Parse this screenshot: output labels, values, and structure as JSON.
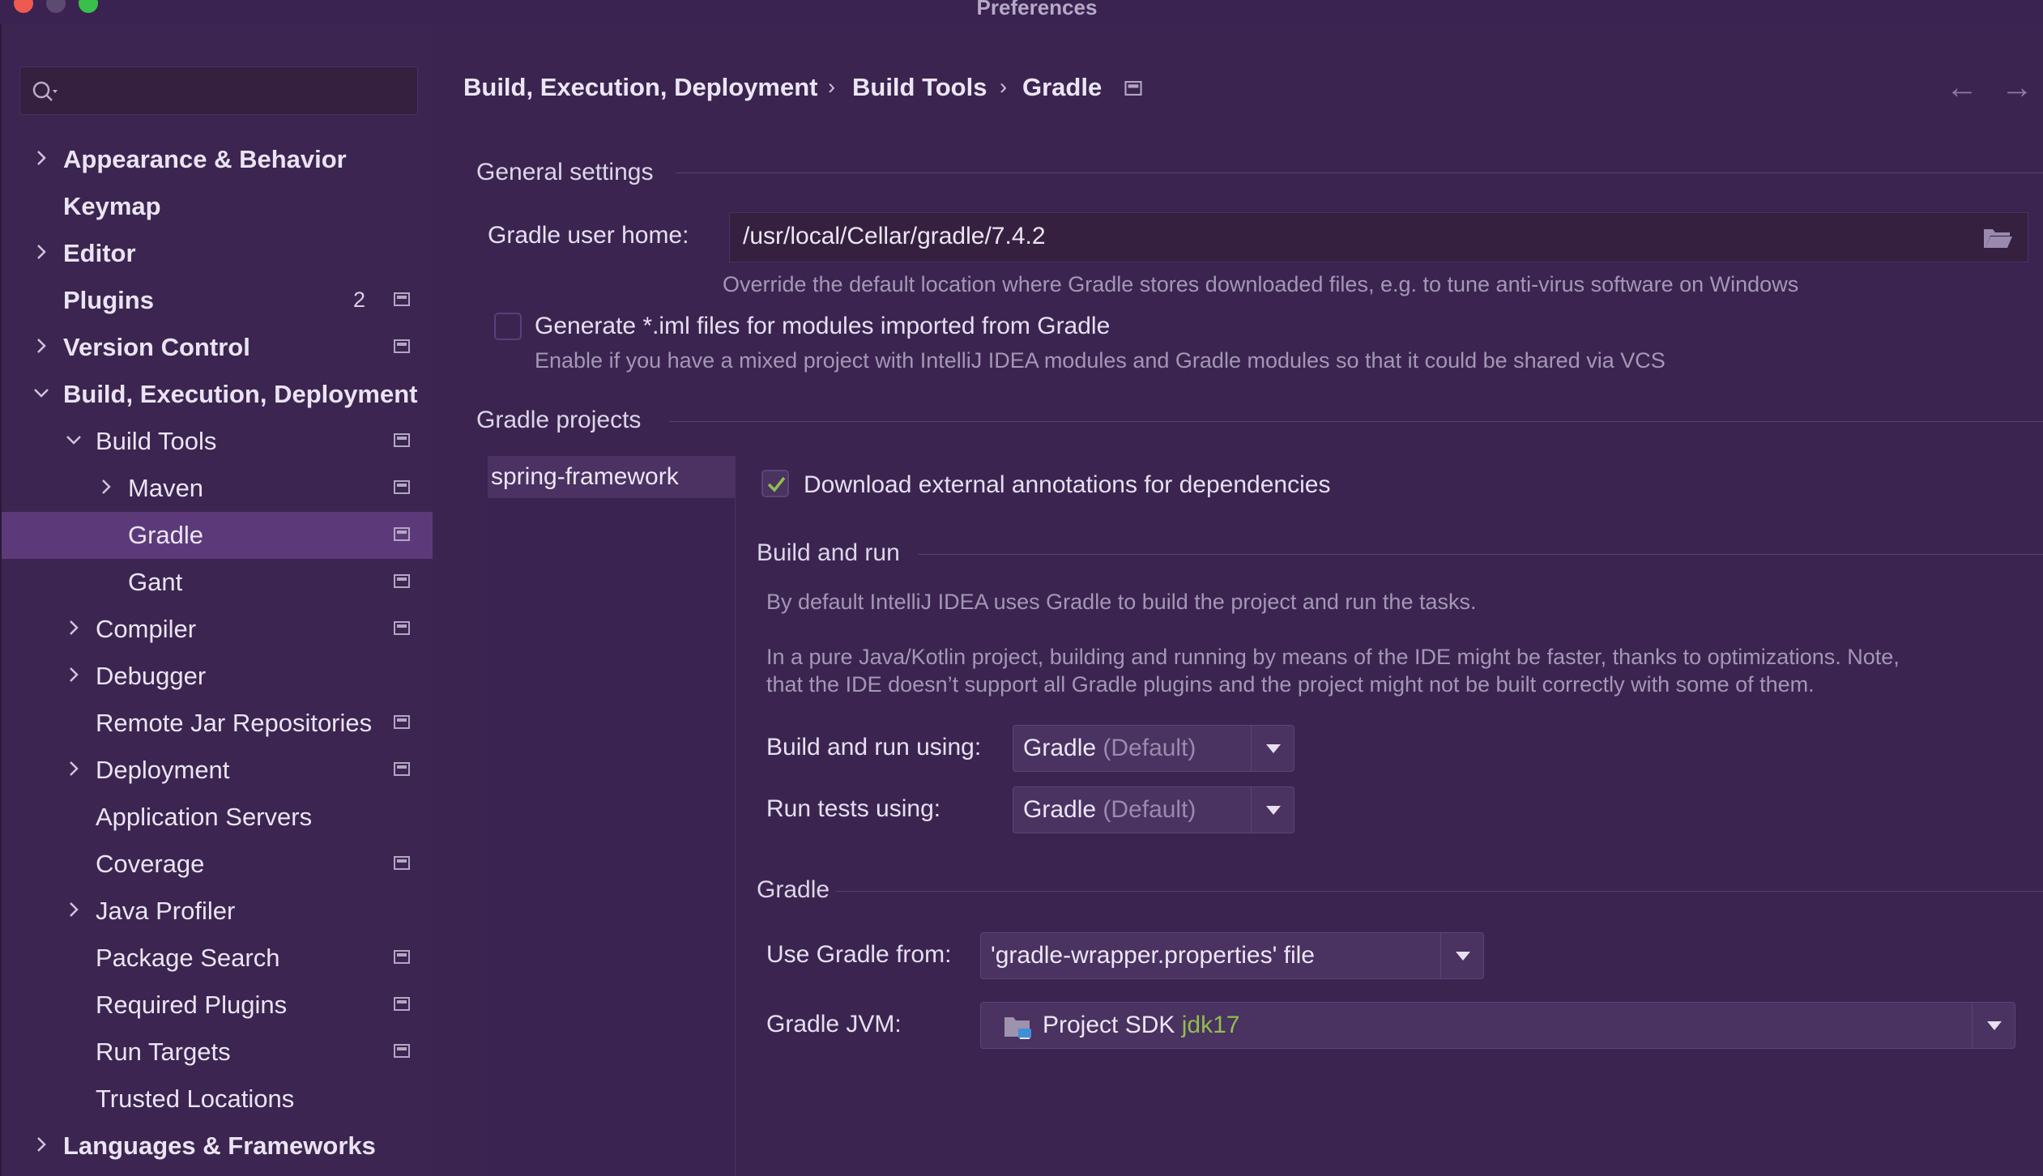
{
  "window": {
    "title": "Preferences"
  },
  "search": {
    "placeholder": ""
  },
  "sidebar": {
    "items": [
      {
        "label": "Appearance & Behavior",
        "bold": true
      },
      {
        "label": "Keymap",
        "bold": true
      },
      {
        "label": "Editor",
        "bold": true
      },
      {
        "label": "Plugins",
        "bold": true,
        "count": "2"
      },
      {
        "label": "Version Control",
        "bold": true
      },
      {
        "label": "Build, Execution, Deployment",
        "bold": true
      },
      {
        "label": "Build Tools"
      },
      {
        "label": "Maven"
      },
      {
        "label": "Gradle",
        "selected": true
      },
      {
        "label": "Gant"
      },
      {
        "label": "Compiler"
      },
      {
        "label": "Debugger"
      },
      {
        "label": "Remote Jar Repositories"
      },
      {
        "label": "Deployment"
      },
      {
        "label": "Application Servers"
      },
      {
        "label": "Coverage"
      },
      {
        "label": "Java Profiler"
      },
      {
        "label": "Package Search"
      },
      {
        "label": "Required Plugins"
      },
      {
        "label": "Run Targets"
      },
      {
        "label": "Trusted Locations"
      },
      {
        "label": "Languages & Frameworks",
        "bold": true
      }
    ]
  },
  "breadcrumb": {
    "items": [
      "Build, Execution, Deployment",
      "Build Tools",
      "Gradle"
    ],
    "separator": "›"
  },
  "general": {
    "title": "General settings",
    "user_home_label": "Gradle user home:",
    "user_home_value": "/usr/local/Cellar/gradle/7.4.2",
    "user_home_hint": "Override the default location where Gradle stores downloaded files, e.g. to tune anti-virus software on Windows",
    "iml_label": "Generate *.iml files for modules imported from Gradle",
    "iml_checked": false,
    "iml_hint": "Enable if you have a mixed project with IntelliJ IDEA modules and Gradle modules so that it could be shared via VCS"
  },
  "projects": {
    "title": "Gradle projects",
    "items": [
      "spring-framework"
    ],
    "download_annotations_label": "Download external annotations for dependencies",
    "download_annotations_checked": true
  },
  "build_and_run": {
    "title": "Build and run",
    "hint1": "By default IntelliJ IDEA uses Gradle to build the project and run the tasks.",
    "hint2_line1": "In a pure Java/Kotlin project, building and running by means of the IDE might be faster, thanks to optimizations. Note,",
    "hint2_line2": "that the IDE doesn’t support all Gradle plugins and the project might not be built correctly with some of them.",
    "build_using_label": "Build and run using:",
    "build_using_value": "Gradle",
    "build_using_suffix": "(Default)",
    "tests_using_label": "Run tests using:",
    "tests_using_value": "Gradle",
    "tests_using_suffix": "(Default)"
  },
  "gradle": {
    "title": "Gradle",
    "use_from_label": "Use Gradle from:",
    "use_from_value": "'gradle-wrapper.properties' file",
    "jvm_label": "Gradle JVM:",
    "jvm_value": "Project SDK",
    "jvm_version": "jdk17"
  },
  "colors": {
    "background": "#3b2550",
    "selection": "#5c3a7a",
    "check_green": "#8fbf4c",
    "close_red": "#ee5a50",
    "maximize_green": "#39c04a"
  }
}
